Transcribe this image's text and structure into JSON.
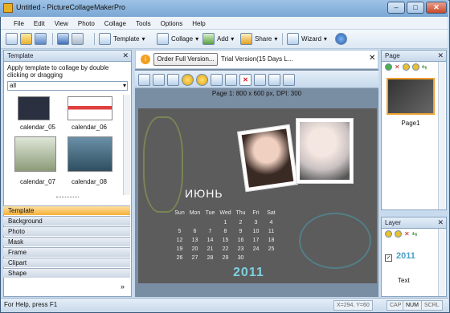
{
  "window": {
    "title": "Untitled - PictureCollageMakerPro"
  },
  "menu": [
    "File",
    "Edit",
    "View",
    "Photo",
    "Collage",
    "Tools",
    "Options",
    "Help"
  ],
  "toolbar": {
    "template": "Template",
    "collage": "Collage",
    "add": "Add",
    "share": "Share",
    "wizard": "Wizard"
  },
  "notice": {
    "button": "Order Full Version...",
    "text": "Trial Version(15 Days L..."
  },
  "canvas": {
    "info": "Page 1: 800 x 600 px, DPI: 300",
    "month": "ИЮНЬ",
    "year": "2011",
    "weekdays": [
      "Sun",
      "Mon",
      "Tue",
      "Wed",
      "Thu",
      "Fri",
      "Sat"
    ],
    "weeks": [
      [
        "",
        "",
        "",
        "1",
        "2",
        "3",
        "4"
      ],
      [
        "5",
        "6",
        "7",
        "8",
        "9",
        "10",
        "11"
      ],
      [
        "12",
        "13",
        "14",
        "15",
        "16",
        "17",
        "18"
      ],
      [
        "19",
        "20",
        "21",
        "22",
        "23",
        "24",
        "25"
      ],
      [
        "26",
        "27",
        "28",
        "29",
        "30",
        "",
        ""
      ]
    ]
  },
  "left": {
    "header": "Template",
    "hint": "Apply template to collage by double clicking or dragging",
    "filter": "all",
    "thumbs": [
      {
        "label": "calendar_05"
      },
      {
        "label": "calendar_06"
      },
      {
        "label": "calendar_07"
      },
      {
        "label": "calendar_08"
      }
    ],
    "categories": [
      "Template",
      "Background",
      "Photo",
      "Mask",
      "Frame",
      "Clipart",
      "Shape"
    ]
  },
  "page_panel": {
    "header": "Page",
    "item": "Page1"
  },
  "layer_panel": {
    "header": "Layer",
    "item": "Text",
    "year": "2011"
  },
  "status": {
    "help": "For Help, press F1",
    "coords": "X=294, Y=60",
    "cap": "CAP",
    "num": "NUM",
    "scrl": "SCRL"
  },
  "colors": {
    "accent": "#f6b03a",
    "title": "#7aa7d4",
    "canvas": "#5c5c5c"
  }
}
